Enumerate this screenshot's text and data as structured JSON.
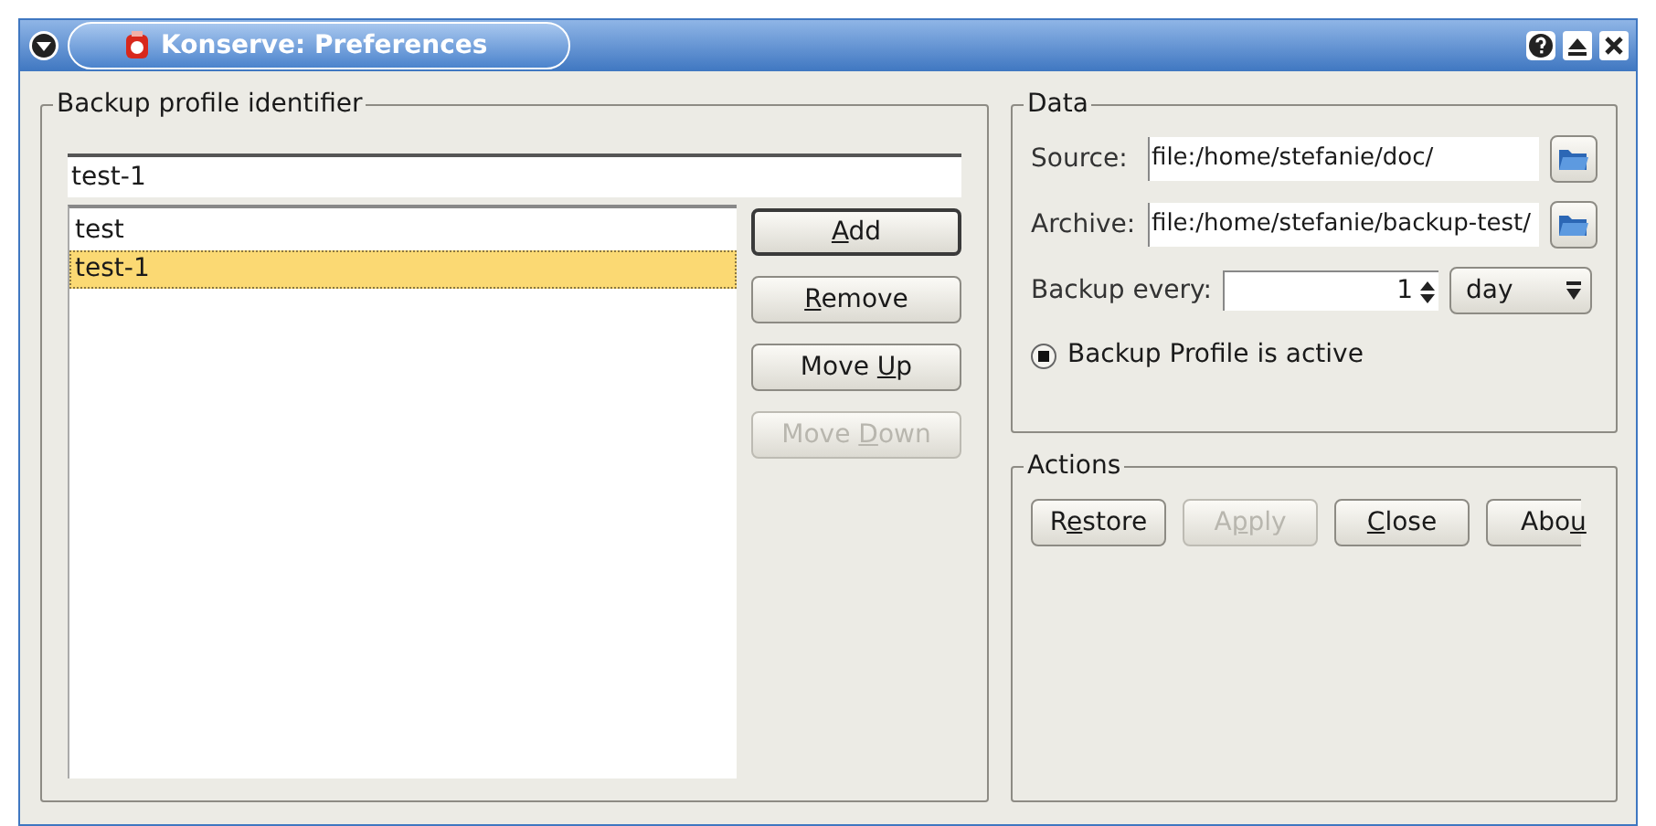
{
  "window": {
    "title": "Konserve: Preferences"
  },
  "profile": {
    "legend": "Backup profile identifier",
    "value": "test-1",
    "items": [
      {
        "label": "test",
        "selected": false
      },
      {
        "label": "test-1",
        "selected": true
      }
    ],
    "buttons": [
      {
        "key": "A",
        "post": "dd",
        "default": true,
        "disabled": false
      },
      {
        "key": "R",
        "post": "emove",
        "default": false,
        "disabled": false
      },
      {
        "pre": "Move ",
        "key": "U",
        "post": "p",
        "default": false,
        "disabled": false
      },
      {
        "pre": "Move ",
        "key": "D",
        "post": "own",
        "default": false,
        "disabled": true
      }
    ]
  },
  "data": {
    "legend": "Data",
    "source_label": "Source:",
    "source": "file:/home/stefanie/doc/",
    "archive_label": "Archive:",
    "archive": "file:/home/stefanie/backup-test/",
    "every_label": "Backup every:",
    "every": "1",
    "unit": "day",
    "active_label": "Backup Profile is active",
    "active": true
  },
  "actions": {
    "legend": "Actions",
    "buttons": [
      {
        "pre": "R",
        "key": "e",
        "post": "store",
        "disabled": false
      },
      {
        "pre": "A",
        "key": "p",
        "post": "ply",
        "disabled": true
      },
      {
        "key": "C",
        "post": "lose",
        "disabled": false
      },
      {
        "pre": "Abo",
        "key": "u",
        "disabled": false
      }
    ]
  }
}
